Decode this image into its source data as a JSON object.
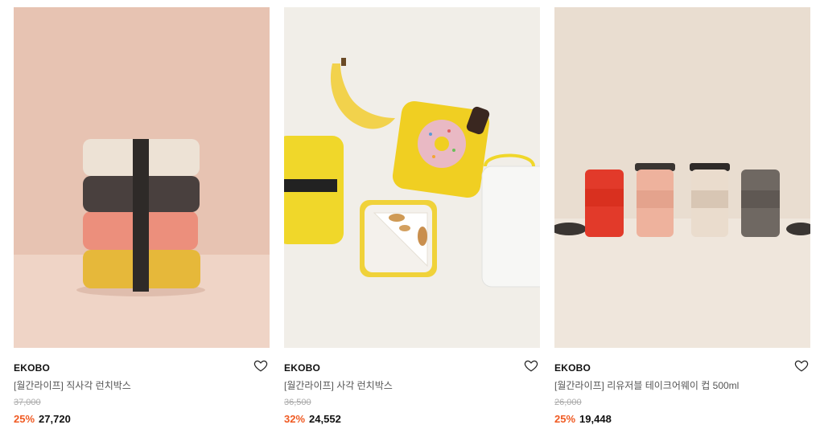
{
  "products": [
    {
      "brand": "EKOBO",
      "title": "[월간라이프] 직사각 런치박스",
      "original_price": "37,000",
      "discount": "25%",
      "price": "27,720",
      "wishlist_icon": "heart-outline-icon"
    },
    {
      "brand": "EKOBO",
      "title": "[월간라이프] 사각 런치박스",
      "original_price": "36,500",
      "discount": "32%",
      "price": "24,552",
      "wishlist_icon": "heart-outline-icon"
    },
    {
      "brand": "EKOBO",
      "title": "[월간라이프] 리유저블 테이크어웨이 컵 500ml",
      "original_price": "26,000",
      "discount": "25%",
      "price": "19,448",
      "wishlist_icon": "heart-outline-icon"
    }
  ],
  "colors": {
    "discount": "#f05a22",
    "strike_price": "#aaaaaa"
  }
}
